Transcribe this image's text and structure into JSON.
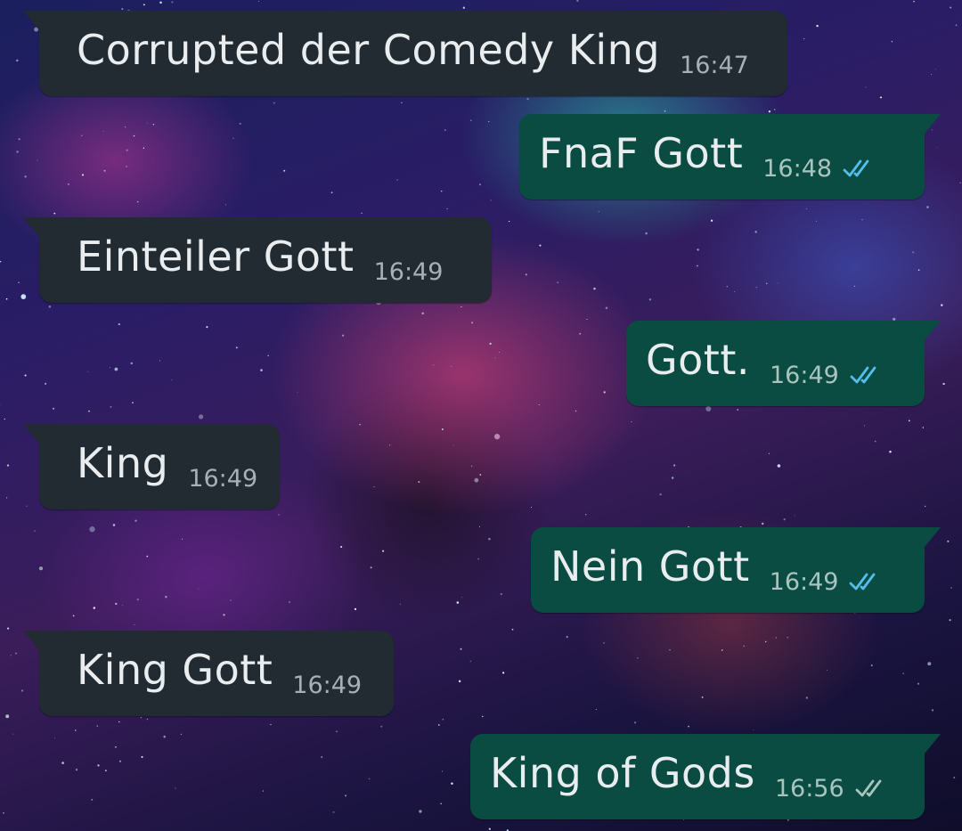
{
  "messages": [
    {
      "direction": "incoming",
      "text": "Corrupted der Comedy King",
      "time": "16:47"
    },
    {
      "direction": "outgoing",
      "text": "FnaF Gott",
      "time": "16:48",
      "status": "read"
    },
    {
      "direction": "incoming",
      "text": "Einteiler Gott",
      "time": "16:49"
    },
    {
      "direction": "outgoing",
      "text": "Gott.",
      "time": "16:49",
      "status": "read"
    },
    {
      "direction": "incoming",
      "text": "King",
      "time": "16:49"
    },
    {
      "direction": "outgoing",
      "text": "Nein Gott",
      "time": "16:49",
      "status": "read"
    },
    {
      "direction": "incoming",
      "text": "King Gott",
      "time": "16:49"
    },
    {
      "direction": "outgoing",
      "text": "King of Gods",
      "time": "16:56",
      "status": "delivered"
    }
  ],
  "colors": {
    "incoming_bubble": "#212b31",
    "outgoing_bubble": "#0a4c41",
    "read_tick": "#53bdeb",
    "delivered_tick": "#a9c4bf",
    "message_text": "#e9edef"
  },
  "icons": {
    "read_status": "double-check-blue-icon",
    "delivered_status": "double-check-grey-icon"
  }
}
